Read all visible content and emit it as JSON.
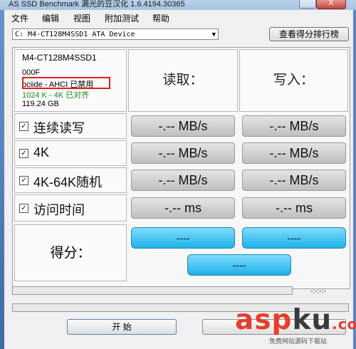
{
  "window": {
    "title": "AS SSD Benchmark 漏光的豆汉化 1.6.4194.30365",
    "close_label": "X"
  },
  "menu": {
    "file": "文件",
    "edit": "编辑",
    "view": "视图",
    "tests": "附加测试",
    "help": "帮助"
  },
  "drive": {
    "selected": "C: M4-CT128M4SSD1 ATA Device",
    "arrow": "▼"
  },
  "rank_button": "查看得分排行榜",
  "info": {
    "model": "M4-CT128M4SSD1",
    "firmware": "000F",
    "driver": "pciide - AHCI 已禁用",
    "alignment": "1024 K - 4K 已对齐",
    "size": "119.24 GB"
  },
  "headers": {
    "read": "读取：",
    "write": "写入："
  },
  "rows": [
    {
      "label": "连续读写",
      "read": "-.-- MB/s",
      "write": "-.-- MB/s"
    },
    {
      "label": "4K",
      "read": "-.-- MB/s",
      "write": "-.-- MB/s"
    },
    {
      "label": "4K-64K随机",
      "read": "-.-- MB/s",
      "write": "-.-- MB/s"
    },
    {
      "label": "访问时间",
      "read": "-.-- ms",
      "write": "-.-- ms"
    }
  ],
  "score": {
    "label": "得分：",
    "read": "----",
    "write": "----",
    "total": "----"
  },
  "timer": "-:-:-:-",
  "start_button": "开  始",
  "colors": {
    "highlight": "#e0201c",
    "alignment_ok": "#1a8f1a",
    "score_fill": "#1eb1e8"
  },
  "watermark": {
    "main_a": "asp",
    "main_b": "ku",
    "main_c": ".com",
    "sub": "免费网站源码下载站"
  }
}
